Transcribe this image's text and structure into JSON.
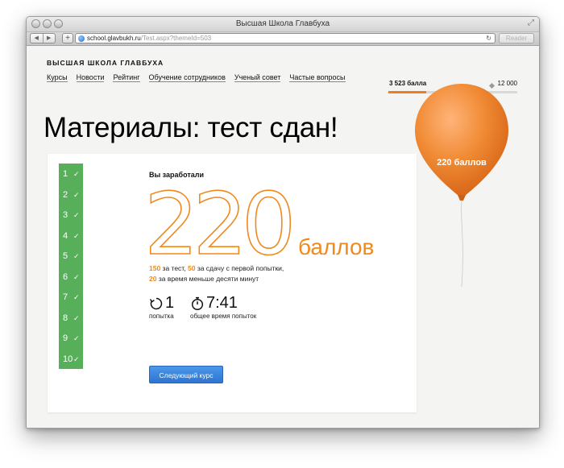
{
  "window": {
    "title": "Высшая Школа Главбуха"
  },
  "browser": {
    "url_host": "school.glavbukh.ru",
    "url_path": "/Test.aspx?themeId=503",
    "reader_label": "Reader",
    "add_label": "+"
  },
  "site": {
    "brand": "ВЫСШАЯ ШКОЛА ГЛАВБУХА",
    "nav": [
      "Курсы",
      "Новости",
      "Рейтинг",
      "Обучение сотрудников",
      "Ученый совет",
      "Частые вопросы"
    ]
  },
  "score_meter": {
    "current_label": "3 523 балла",
    "max_label": "12 000",
    "current": 3523,
    "max": 12000,
    "fill_color": "#f07c1b"
  },
  "heading": "Материалы: тест сдан!",
  "result": {
    "earned_label": "Вы заработали",
    "points": "220",
    "points_unit": "баллов",
    "breakdown": {
      "test_points": "150",
      "test_text": " за тест, ",
      "first_try_points": "50",
      "first_try_text": " за сдачу с первой попытки,",
      "time_points": "20",
      "time_text": " за время меньше десяти минут"
    },
    "attempts_value": "1",
    "attempts_label": "попытка",
    "time_value": "7:41",
    "time_label": "общее время попыток",
    "next_button": "Следующий курс"
  },
  "steps": [
    "1",
    "2",
    "3",
    "4",
    "5",
    "6",
    "7",
    "8",
    "9",
    "10"
  ],
  "balloon": {
    "label": "220 баллов",
    "color": "#f08a33"
  },
  "colors": {
    "accent": "#f08a1d",
    "steps_green": "#58af5a",
    "button_blue": "#3b84dc"
  }
}
